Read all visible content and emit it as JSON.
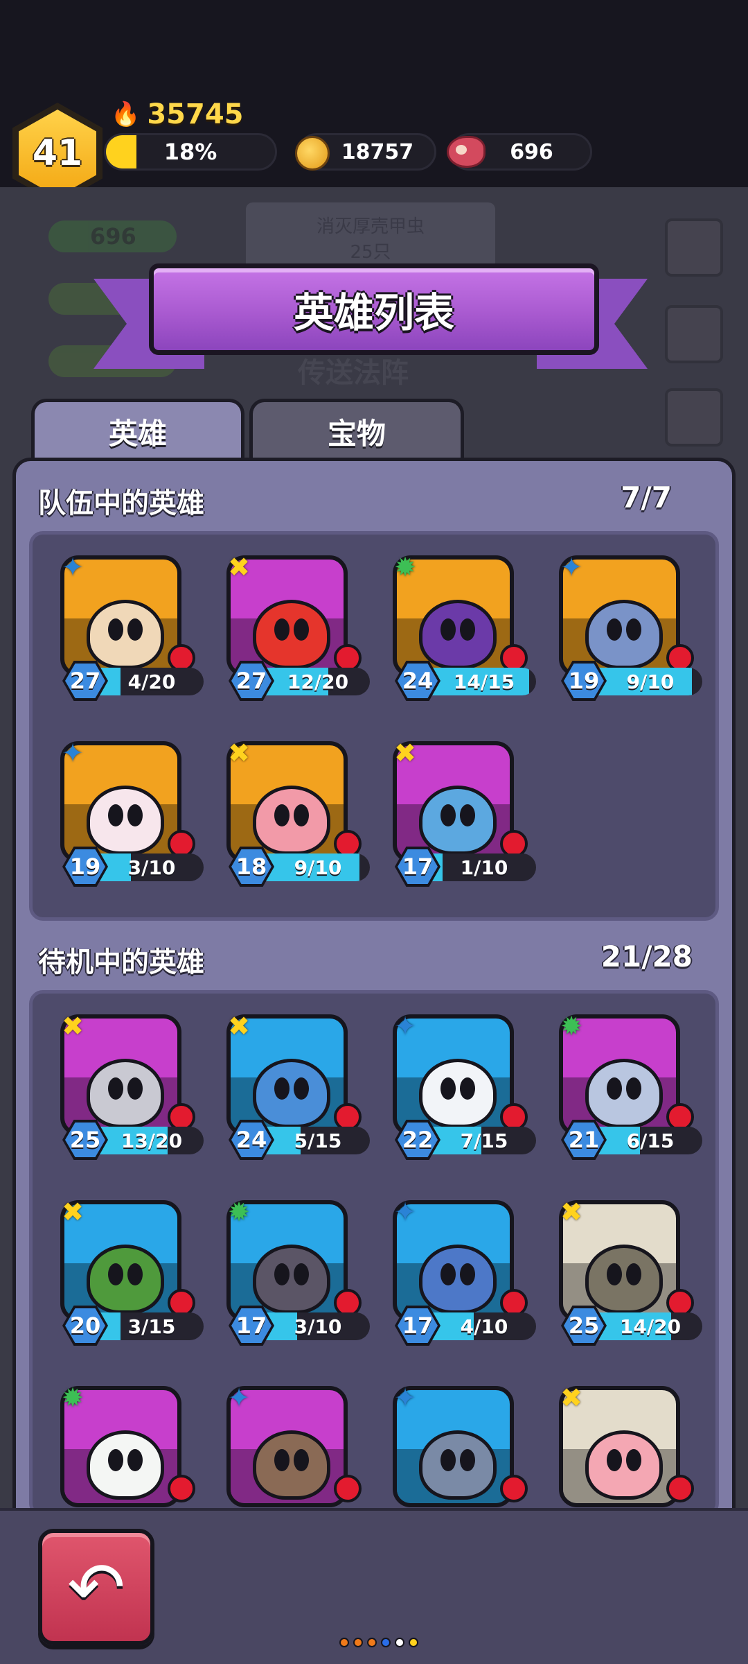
{
  "hud": {
    "player_level": "41",
    "power": "35745",
    "xp_percent_text": "18%",
    "xp_fraction": 0.18,
    "coins": "18757",
    "meat": "696"
  },
  "background": {
    "meat_count": "696",
    "task_line1": "消灭厚壳甲虫",
    "task_line2": "25只",
    "portal_label": "传送法阵"
  },
  "title": "英雄列表",
  "tabs": [
    {
      "label": "英雄",
      "active": true
    },
    {
      "label": "宝物",
      "active": false
    }
  ],
  "team": {
    "title": "队伍中的英雄",
    "count": "7/7",
    "heroes": [
      {
        "level": "27",
        "shards": "4/20",
        "fill": 0.2,
        "bg": "#f2a21f",
        "body": "#f0d8b8",
        "role": "blue"
      },
      {
        "level": "27",
        "shards": "12/20",
        "fill": 0.6,
        "bg": "#c73fcc",
        "body": "#e5352c",
        "role": "yellow"
      },
      {
        "level": "24",
        "shards": "14/15",
        "fill": 0.93,
        "bg": "#f2a21f",
        "body": "#6b3aa8",
        "role": "green"
      },
      {
        "level": "19",
        "shards": "9/10",
        "fill": 0.9,
        "bg": "#f2a21f",
        "body": "#7a93c8",
        "role": "blue"
      },
      {
        "level": "19",
        "shards": "3/10",
        "fill": 0.3,
        "bg": "#f2a21f",
        "body": "#f7e6ec",
        "role": "blue"
      },
      {
        "level": "18",
        "shards": "9/10",
        "fill": 0.9,
        "bg": "#f2a21f",
        "body": "#f29aa8",
        "role": "yellow"
      },
      {
        "level": "17",
        "shards": "1/10",
        "fill": 0.1,
        "bg": "#c73fcc",
        "body": "#5ca8e0",
        "role": "yellow"
      }
    ]
  },
  "bench": {
    "title": "待机中的英雄",
    "count": "21/28",
    "heroes": [
      {
        "level": "25",
        "shards": "13/20",
        "fill": 0.65,
        "bg": "#c73fcc",
        "body": "#c9c9d2",
        "role": "yellow"
      },
      {
        "level": "24",
        "shards": "5/15",
        "fill": 0.33,
        "bg": "#2aa7e8",
        "body": "#4a8ed8",
        "role": "yellow"
      },
      {
        "level": "22",
        "shards": "7/15",
        "fill": 0.47,
        "bg": "#2aa7e8",
        "body": "#f2f4f8",
        "role": "blue"
      },
      {
        "level": "21",
        "shards": "6/15",
        "fill": 0.4,
        "bg": "#c73fcc",
        "body": "#b9c6e0",
        "role": "green"
      },
      {
        "level": "20",
        "shards": "3/15",
        "fill": 0.2,
        "bg": "#2aa7e8",
        "body": "#4f9a3c",
        "role": "yellow"
      },
      {
        "level": "17",
        "shards": "3/10",
        "fill": 0.3,
        "bg": "#2aa7e8",
        "body": "#5b5566",
        "role": "green"
      },
      {
        "level": "17",
        "shards": "4/10",
        "fill": 0.4,
        "bg": "#2aa7e8",
        "body": "#4d78c8",
        "role": "blue"
      },
      {
        "level": "25",
        "shards": "14/20",
        "fill": 0.7,
        "bg": "#e3dccb",
        "body": "#7a7464",
        "role": "yellow"
      },
      {
        "level": "",
        "shards": "",
        "fill": 0,
        "bg": "#c73fcc",
        "body": "#f4f6f4",
        "role": "green"
      },
      {
        "level": "",
        "shards": "",
        "fill": 0,
        "bg": "#c73fcc",
        "body": "#8a6a55",
        "role": "blue"
      },
      {
        "level": "",
        "shards": "",
        "fill": 0,
        "bg": "#2aa7e8",
        "body": "#7a8aa6",
        "role": "blue"
      },
      {
        "level": "",
        "shards": "",
        "fill": 0,
        "bg": "#e3dccb",
        "body": "#f4a7b3",
        "role": "yellow"
      }
    ]
  },
  "nav": {
    "back_icon": "back-arrow-icon",
    "page_dots": [
      "#f07a1a",
      "#f07a1a",
      "#f07a1a",
      "#2a6ee8",
      "#ffffff",
      "#ffd21e"
    ]
  }
}
